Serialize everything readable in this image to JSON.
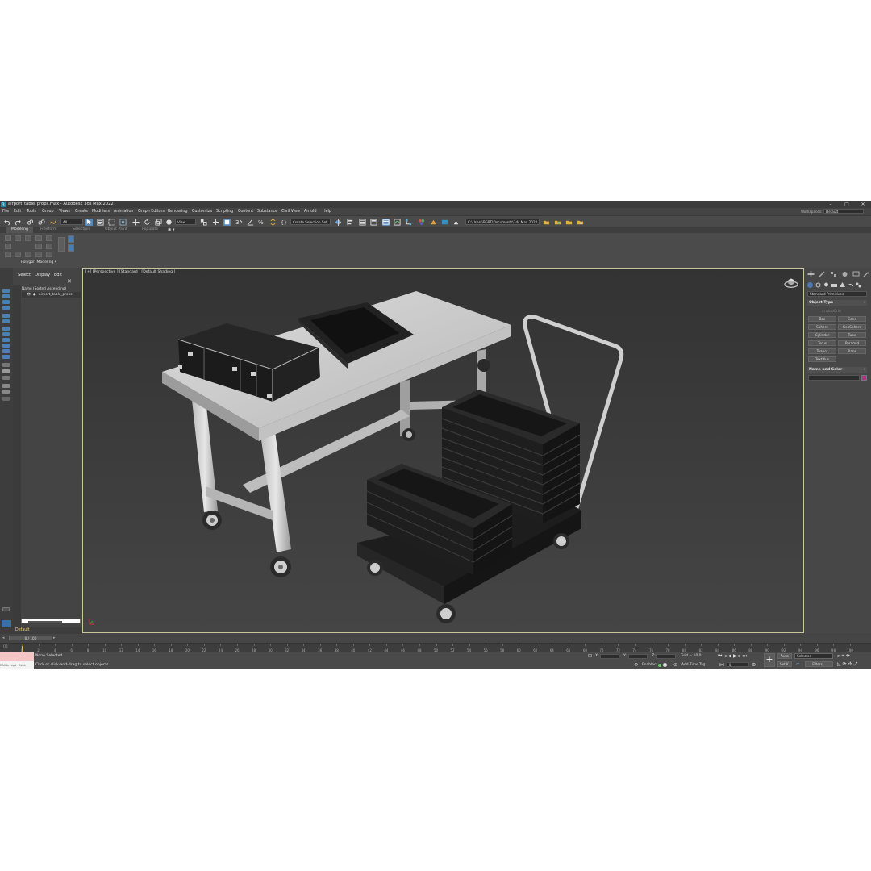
{
  "window": {
    "title": "airport_table_props.max - Autodesk 3ds Max 2022",
    "minimize": "–",
    "maximize": "□",
    "close": "✕"
  },
  "menu": [
    "File",
    "Edit",
    "Tools",
    "Group",
    "Views",
    "Create",
    "Modifiers",
    "Animation",
    "Graph Editors",
    "Rendering",
    "Customize",
    "Scripting",
    "Content",
    "Substance",
    "Civil View",
    "Arnold",
    "Help"
  ],
  "workspace": {
    "label": "Workspaces:",
    "value": "Default"
  },
  "toolbar": {
    "selection_filter": "All",
    "ref_coord": "View",
    "named_selection": "Create Selection Set",
    "project_path": "C:\\Users\\BGRT\\Documents\\3ds Max 2022"
  },
  "ribbon": {
    "tabs": [
      "Modeling",
      "Freeform",
      "Selection",
      "Object Paint",
      "Populate"
    ],
    "panel_label": "Polygon Modeling"
  },
  "scene_explorer": {
    "tabs": [
      "Select",
      "Display",
      "Edit"
    ],
    "close": "✕",
    "column_header": "Name (Sorted Ascending)",
    "items": [
      "airport_table_props"
    ]
  },
  "layer": {
    "name": "Default"
  },
  "viewport": {
    "label": "[+] [Perspective ] [Standard ] [Default Shading ]"
  },
  "command_panel": {
    "category": "Standard Primitives",
    "object_type_title": "Object Type",
    "autogrid": "AutoGrid",
    "primitives": [
      "Box",
      "Cone",
      "Sphere",
      "GeoSphere",
      "Cylinder",
      "Tube",
      "Torus",
      "Pyramid",
      "Teapot",
      "Plane",
      "TextPlus"
    ],
    "name_color_title": "Name and Color",
    "object_color": "#c02a86"
  },
  "timeline": {
    "frame_display": "0 / 100",
    "ticks": [
      0,
      2,
      4,
      6,
      8,
      10,
      12,
      14,
      16,
      18,
      20,
      22,
      24,
      26,
      28,
      30,
      32,
      34,
      36,
      38,
      40,
      42,
      44,
      46,
      48,
      50,
      52,
      54,
      56,
      58,
      60,
      62,
      64,
      66,
      68,
      70,
      72,
      74,
      76,
      78,
      80,
      82,
      84,
      86,
      88,
      90,
      92,
      94,
      96,
      98,
      100
    ]
  },
  "status": {
    "maxscript_label": "MAXScript Mini",
    "selection": "None Selected",
    "prompt": "Click or click-and-drag to select objects",
    "x_label": "X:",
    "y_label": "Y:",
    "z_label": "Z:",
    "grid": "Grid = 10,0",
    "enabled": "Enabled:",
    "add_time_tag": "Add Time Tag",
    "auto": "Auto",
    "set_k": "Set K.",
    "key_mode": "Selected",
    "filters": "Filters...",
    "frame": "0"
  }
}
